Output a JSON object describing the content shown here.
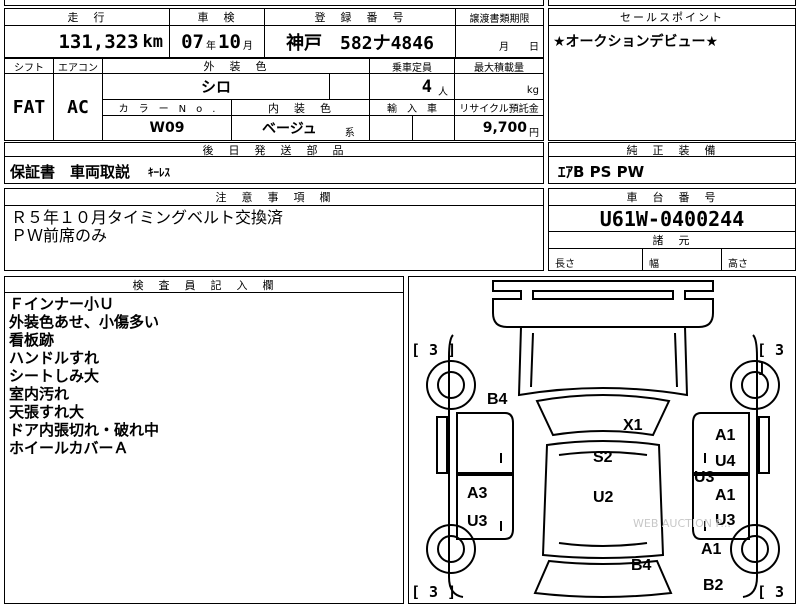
{
  "headers": {
    "mileage": "走　行",
    "inspection": "車　検",
    "registration": "登　録　番　号",
    "transfer_deadline": "譲渡書類期限",
    "sales_point": "セールスポイント",
    "shift": "シフト",
    "aircon": "エアコン",
    "exterior_color": "外　装　色",
    "capacity": "乗車定員",
    "max_load": "最大積載量",
    "color_no": "カ　ラ　ー　N　o　.",
    "interior_color": "内　装　色",
    "import": "輸　入　車",
    "recycle": "リサイクル預託金",
    "after_shipping": "後　日　発　送　部　品",
    "standard_equipment": "純　正　装　備",
    "notes": "注　意　事　項　欄",
    "chassis_no": "車　台　番　号",
    "dimensions": "諸　元",
    "inspector": "検　査　員　記　入　欄"
  },
  "vehicle": {
    "mileage_value": "131,323",
    "mileage_unit": "km",
    "inspection_year": "07",
    "year_unit": "年",
    "inspection_month": "10",
    "month_unit": "月",
    "registration": "神戸　582ナ4846",
    "transfer_month_unit": "月",
    "transfer_day_unit": "日",
    "shift": "FAT",
    "aircon": "AC",
    "exterior_color": "シロ",
    "capacity": "4",
    "capacity_unit": "人",
    "load_unit": "kg",
    "color_no": "W09",
    "interior_color": "ベージュ",
    "interior_suffix": "系",
    "recycle_value": "9,700",
    "recycle_unit": "円",
    "chassis_no": "U61W-0400244",
    "length_label": "長さ",
    "width_label": "幅",
    "height_label": "高さ"
  },
  "sales_point_text": "★オークションデビュー★",
  "after_shipping_text": "保証書　車両取説",
  "after_shipping_small": "ｷｰﾚｽ",
  "standard_equipment_text": "ｴｱB  PS  PW",
  "notes_lines": [
    "Ｒ５年１０月タイミングベルト交換済",
    "ＰＷ前席のみ"
  ],
  "inspector_lines": [
    "Ｆインナー小Ｕ",
    "外装色あせ、小傷多い",
    "看板跡",
    "ハンドルすれ",
    "シートしみ大",
    "室内汚れ",
    "天張すれ大",
    "ドア内張切れ・破れ中",
    "ホイールカバーＡ"
  ],
  "diagram": {
    "tire_tl": "[ 3 ]",
    "tire_tr": "[ 3 ]",
    "tire_bl": "[ 3 ]",
    "tire_br": "[ 3 ]",
    "marks": {
      "b4_top": "B4",
      "x1": "X1",
      "s2": "S2",
      "u2": "U2",
      "a3": "A3",
      "u3_left": "U3",
      "b4_bottom": "B4",
      "a1_1": "A1",
      "u4": "U4",
      "u3_mid": "U3",
      "a1_2": "A1",
      "u3_right": "U3",
      "a1_3": "A1",
      "b2": "B2"
    },
    "watermark": "WEB AUCTION P..."
  }
}
